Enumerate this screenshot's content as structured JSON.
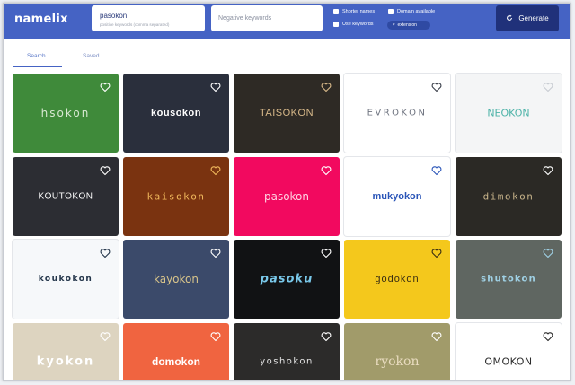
{
  "header": {
    "logo": "namelix",
    "positive_keywords": {
      "value": "pasokon",
      "hint": "positive keywords (comma separated)"
    },
    "negative_keywords": {
      "placeholder": "Negative keywords"
    },
    "options": {
      "shorter_names": "Shorter names",
      "domain_available": "Domain available",
      "use_keywords": "Use keywords",
      "extension": "extension"
    },
    "generate_label": "Generate"
  },
  "tabs": [
    {
      "label": "Search",
      "active": true
    },
    {
      "label": "Saved",
      "active": false
    }
  ],
  "names": [
    {
      "text": "hsokon",
      "bg": "#3f8a3a",
      "fg": "#d8e8d2",
      "heart": "#ffffff"
    },
    {
      "text": "kousokon",
      "bg": "#2a2f3c",
      "fg": "#ffffff",
      "heart": "#ffffff"
    },
    {
      "text": "TAISOKON",
      "bg": "#2e2a25",
      "fg": "#d8b98a",
      "heart": "#d8b98a"
    },
    {
      "text": "EVROKON",
      "bg": "#ffffff",
      "fg": "#6f7480",
      "heart": "#3a3f4a"
    },
    {
      "text": "NEOKON",
      "bg": "#f4f5f6",
      "fg": "#4db3a8",
      "heart": "#c8ccd2"
    },
    {
      "text": "KOUTOKON",
      "bg": "#2c2d33",
      "fg": "#ffffff",
      "heart": "#ffffff"
    },
    {
      "text": "kaisokon",
      "bg": "#7a3310",
      "fg": "#f0b85c",
      "heart": "#f0b85c"
    },
    {
      "text": "pasokon",
      "bg": "#f2095f",
      "fg": "#ffd3e2",
      "heart": "#ffffff"
    },
    {
      "text": "mukyokon",
      "bg": "#ffffff",
      "fg": "#2a55b8",
      "heart": "#2a55b8"
    },
    {
      "text": "dimokon",
      "bg": "#2b2925",
      "fg": "#c7b38a",
      "heart": "#ffffff"
    },
    {
      "text": "koukokon",
      "bg": "#f6f8fa",
      "fg": "#23354a",
      "heart": "#23354a"
    },
    {
      "text": "kayokon",
      "bg": "#3b4a6a",
      "fg": "#d8c48a",
      "heart": "#ffffff"
    },
    {
      "text": "pasoku",
      "bg": "#111214",
      "fg": "#79c8ea",
      "heart": "#ffffff"
    },
    {
      "text": "godokon",
      "bg": "#f4c81c",
      "fg": "#3a2e12",
      "heart": "#3a2e12"
    },
    {
      "text": "shutokon",
      "bg": "#5f6661",
      "fg": "#9fd0e4",
      "heart": "#9fd0e4"
    },
    {
      "text": "kyokon",
      "bg": "#ddd4c0",
      "fg": "#ffffff",
      "heart": "#ffffff"
    },
    {
      "text": "domokon",
      "bg": "#f06440",
      "fg": "#ffffff",
      "heart": "#ffffff"
    },
    {
      "text": "yoshokon",
      "bg": "#2c2b2a",
      "fg": "#e4e4e4",
      "heart": "#ffffff"
    },
    {
      "text": "ryokon",
      "bg": "#a19b6a",
      "fg": "#e9dcc0",
      "heart": "#ffffff"
    },
    {
      "text": "OMOKON",
      "bg": "#ffffff",
      "fg": "#2a2a2a",
      "heart": "#2a2a2a"
    }
  ]
}
